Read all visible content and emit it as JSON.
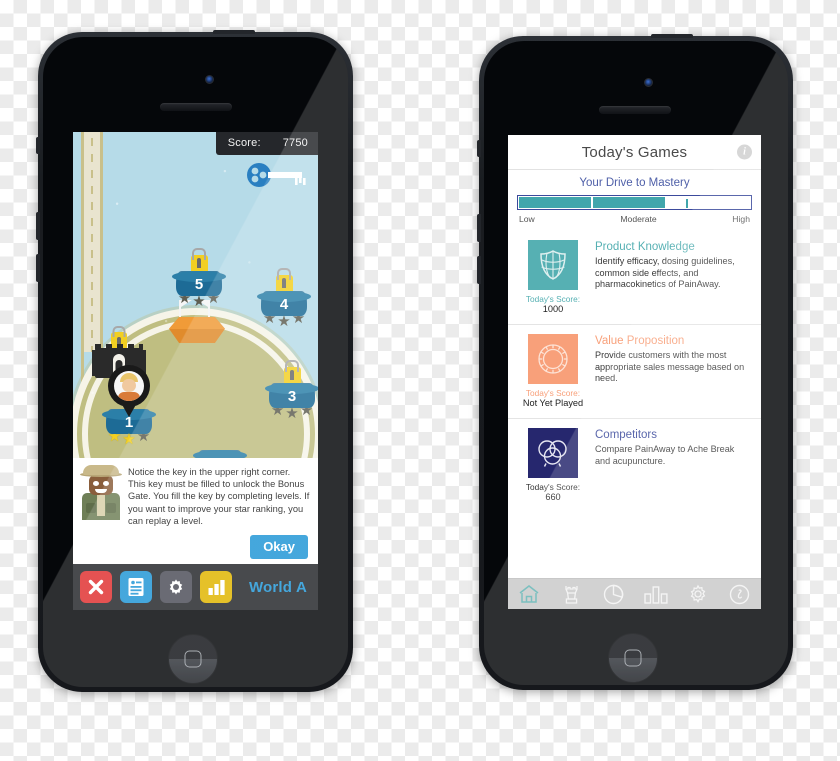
{
  "left_phone": {
    "game": {
      "score_label": "Score:",
      "score_value": "7750",
      "key_icon": "key-icon",
      "levels": [
        {
          "number": "5",
          "stars_filled": 0,
          "locked": true
        },
        {
          "number": "4",
          "stars_filled": 0,
          "locked": true
        },
        {
          "number": "3",
          "stars_filled": 0,
          "locked": true
        },
        {
          "number": "1",
          "stars_filled": 2,
          "locked": false
        }
      ],
      "bonus_gate": {
        "name": "bonus-gate",
        "locked": true
      },
      "avatar": "player-avatar",
      "tutorial": {
        "text": "Notice the key in the upper right corner. This key must be filled to unlock the Bonus Gate. You fill the key by completing levels. If you want to improve your star ranking, you can replay a level.",
        "button_label": "Okay"
      },
      "toolbar": {
        "close_label": "✕",
        "world_label": "World A",
        "buttons": [
          {
            "name": "close-button",
            "icon": "close-icon",
            "color": "#e03131"
          },
          {
            "name": "notes-button",
            "icon": "document-icon",
            "color": "#2196d6"
          },
          {
            "name": "settings-button",
            "icon": "gear-icon",
            "color": "#4d4f59"
          },
          {
            "name": "stats-button",
            "icon": "bar-chart-icon",
            "color": "#e0b500"
          }
        ]
      }
    }
  },
  "right_phone": {
    "app": {
      "title": "Today's Games",
      "info_icon": "info-icon",
      "info_glyph": "i",
      "mastery": {
        "title": "Your Drive to Mastery",
        "labels": [
          "Low",
          "Moderate",
          "High"
        ],
        "bar_color": "#41a6ac",
        "border_color": "#3b4a9c",
        "segments": [
          24,
          32
        ],
        "tick_position": 72
      },
      "games": [
        {
          "title": "Product Knowledge",
          "description": "Identify efficacy, dosing guidelines, common side effects, and pharmacokinetics of PainAway.",
          "score_label": "Today's Score:",
          "score_value": "1000",
          "color": "#56b0b3",
          "icon": "shield-icon"
        },
        {
          "title": "Value Proposition",
          "description": "Provide customers with the most appropriate sales message based on need.",
          "score_label": "Today's Score:",
          "score_value": "Not Yet Played",
          "color": "#f8a07a",
          "icon": "target-ring-icon"
        },
        {
          "title": "Competitors",
          "description": "Compare PainAway to Ache Break and acupuncture.",
          "score_label": "Today's Score:",
          "score_value": "660",
          "color": "#26276e",
          "icon": "venn-circles-icon"
        }
      ],
      "tabs": [
        {
          "name": "tab-home",
          "icon": "home-icon",
          "active": true
        },
        {
          "name": "tab-games",
          "icon": "chess-rook-icon",
          "active": false
        },
        {
          "name": "tab-progress",
          "icon": "pie-chart-icon",
          "active": false
        },
        {
          "name": "tab-stats",
          "icon": "bar-chart-icon",
          "active": false
        },
        {
          "name": "tab-settings",
          "icon": "gear-icon",
          "active": false
        },
        {
          "name": "tab-info",
          "icon": "info-icon",
          "active": false
        }
      ]
    }
  }
}
